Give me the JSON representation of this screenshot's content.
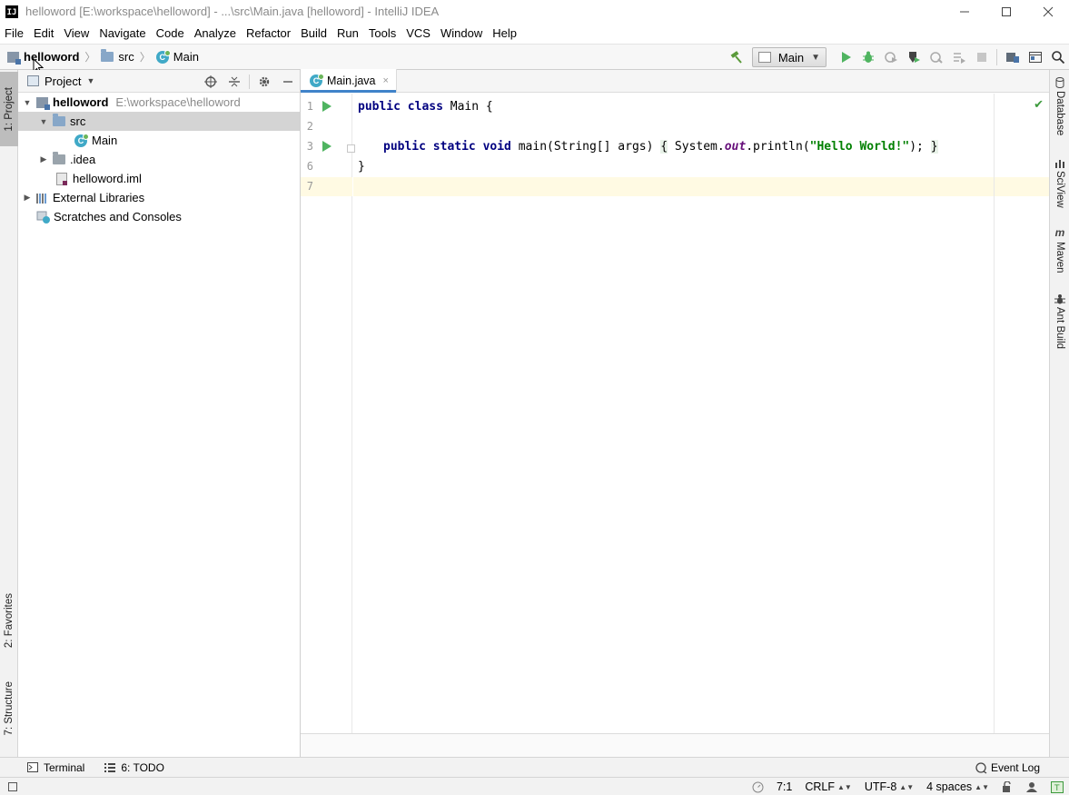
{
  "window": {
    "title": "helloword [E:\\workspace\\helloword] - ...\\src\\Main.java [helloword] - IntelliJ IDEA",
    "logo_text": "IJ"
  },
  "menu": [
    "File",
    "Edit",
    "View",
    "Navigate",
    "Code",
    "Analyze",
    "Refactor",
    "Build",
    "Run",
    "Tools",
    "VCS",
    "Window",
    "Help"
  ],
  "breadcrumb": [
    "helloword",
    "src",
    "Main"
  ],
  "toolbar": {
    "run_config": "Main"
  },
  "left_strip": {
    "project_tab": "1: Project",
    "favorites_tab": "2: Favorites",
    "structure_tab": "7: Structure"
  },
  "right_strip": [
    "Database",
    "SciView",
    "Maven",
    "Ant Build"
  ],
  "project_panel": {
    "title": "Project",
    "tree": [
      {
        "label": "helloword",
        "path": "E:\\workspace\\helloword"
      },
      {
        "label": "src"
      },
      {
        "label": "Main"
      },
      {
        "label": ".idea"
      },
      {
        "label": "helloword.iml"
      },
      {
        "label": "External Libraries"
      },
      {
        "label": "Scratches and Consoles"
      }
    ]
  },
  "editor": {
    "tab": "Main.java",
    "line_numbers": [
      "1",
      "2",
      "3",
      "6",
      "7"
    ],
    "code": {
      "l1_kw": "public class",
      "l1_rest": " Main {",
      "l3_kw1": "public static void",
      "l3_sig": " main(String[] args) ",
      "l3_open": "{",
      "l3_sys": " System.",
      "l3_out": "out",
      "l3_println": ".println(",
      "l3_str": "\"Hello World!\"",
      "l3_end": "); ",
      "l3_close": "}",
      "l6": "}"
    }
  },
  "bottom_tools": {
    "terminal": "Terminal",
    "todo": "6: TODO",
    "event_log": "Event Log"
  },
  "status": {
    "position": "7:1",
    "line_sep": "CRLF",
    "encoding": "UTF-8",
    "indent": "4 spaces"
  },
  "colors": {
    "accent": "#4083c9",
    "run_green": "#4fb460",
    "keyword": "#000080",
    "string": "#008000"
  }
}
